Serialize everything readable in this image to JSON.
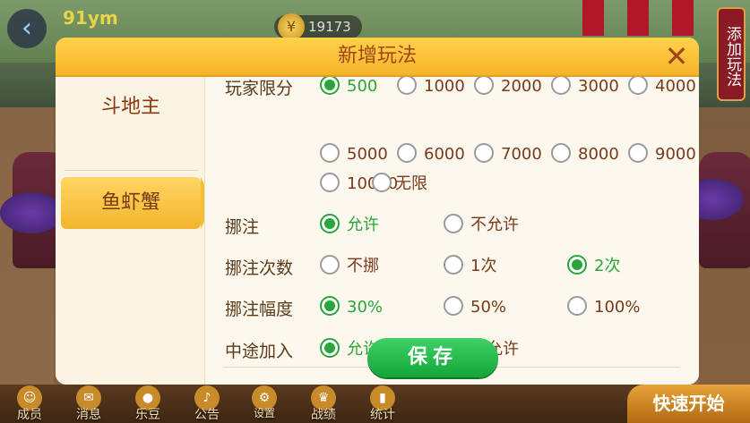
{
  "header": {
    "player_name": "91ym",
    "coins": "19173",
    "coin_icon": "coin-icon",
    "back_icon": "back-arrow-icon",
    "add_play_label": "添加玩法"
  },
  "dialog": {
    "title": "新增玩法",
    "close_icon": "close-icon",
    "sidebar": [
      {
        "label": "斗地主",
        "active": false
      },
      {
        "label": "鱼虾蟹",
        "active": true
      }
    ],
    "rows": [
      {
        "label": "玩家限分",
        "options": [
          "500",
          "1000",
          "2000",
          "3000",
          "4000",
          "5000",
          "6000",
          "7000",
          "8000",
          "9000",
          "10000",
          "无限"
        ],
        "selected": "500"
      },
      {
        "label": "挪注",
        "options": [
          "允许",
          "不允许"
        ],
        "selected": "允许"
      },
      {
        "label": "挪注次数",
        "options": [
          "不挪",
          "1次",
          "2次"
        ],
        "selected": "2次"
      },
      {
        "label": "挪注幅度",
        "options": [
          "30%",
          "50%",
          "100%"
        ],
        "selected": "30%"
      },
      {
        "label": "中途加入",
        "options": [
          "允许",
          "不允许"
        ],
        "selected": "允许"
      }
    ],
    "save_label": "保存"
  },
  "bottombar": {
    "tabs": [
      {
        "label": "成员",
        "icon": "members-icon"
      },
      {
        "label": "消息",
        "icon": "message-icon"
      },
      {
        "label": "乐豆",
        "icon": "bean-icon"
      },
      {
        "label": "公告",
        "icon": "announcement-icon"
      },
      {
        "label": "设置",
        "icon": "settings-icon"
      },
      {
        "label": "战绩",
        "icon": "trophy-icon"
      },
      {
        "label": "统计",
        "icon": "stats-icon"
      }
    ],
    "quick_start": "快速开始"
  },
  "colors": {
    "accent_green": "#2aa53a",
    "header_yellow": "#f6b42a",
    "title_brown": "#a0461a"
  }
}
